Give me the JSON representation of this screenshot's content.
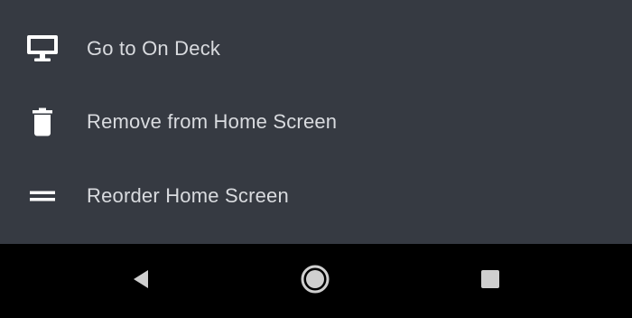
{
  "menu": {
    "items": [
      {
        "icon": "monitor-icon",
        "label": "Go to On Deck"
      },
      {
        "icon": "trash-icon",
        "label": "Remove from Home Screen"
      },
      {
        "icon": "reorder-icon",
        "label": "Reorder Home Screen"
      }
    ]
  },
  "navbar": {
    "buttons": [
      {
        "icon": "back-triangle-icon"
      },
      {
        "icon": "home-circle-icon"
      },
      {
        "icon": "recents-square-icon"
      }
    ]
  },
  "colors": {
    "sheet_background": "#363a42",
    "label_text": "#d9dbdf",
    "icon": "#ffffff",
    "navbar_background": "#000000",
    "nav_icon": "#cfcfcf"
  }
}
